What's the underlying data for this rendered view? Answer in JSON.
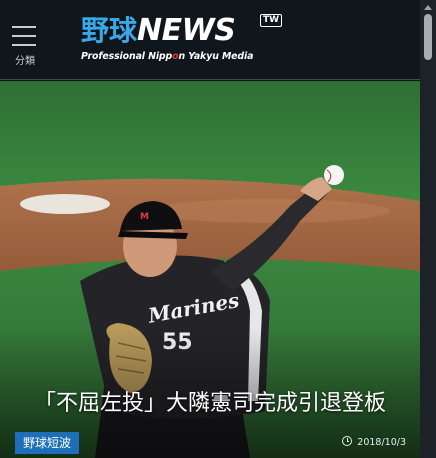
{
  "header": {
    "menu_label": "分類",
    "logo": {
      "kanji": "野球",
      "news": "NEWS",
      "tw": "TW",
      "subtitle_a": "Professional Nipp",
      "subtitle_o": "o",
      "subtitle_b": "n Yakyu Media"
    }
  },
  "hero": {
    "headline": "「不屈左投」大隣憲司完成引退登板",
    "category": "野球短波",
    "date": "2018/10/3",
    "jersey_text": "Marines",
    "jersey_number": "55"
  },
  "icons": {
    "menu": "hamburger-menu-icon",
    "clock": "clock-icon"
  },
  "colors": {
    "header_bg": "#0f161c",
    "logo_kanji": "#3aa7e6",
    "category_bg": "#1e6fb8",
    "field_green": "#3f8a44"
  }
}
